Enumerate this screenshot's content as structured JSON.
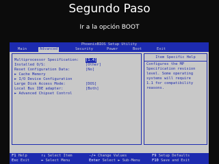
{
  "slide": {
    "title": "Segundo Paso",
    "subtitle": "Ir a la opción BOOT"
  },
  "bios": {
    "title": "PhoenixBIOS Setup Utility",
    "menu": [
      "Main",
      "Advanced",
      "Security",
      "Power",
      "Boot",
      "Exit"
    ],
    "active_menu": "Advanced",
    "settings": [
      {
        "label": "Multiprocessor Specification:",
        "value": "[1.4]",
        "selected": true
      },
      {
        "label": "Installed O/S:",
        "value": "[Other]"
      },
      {
        "label": "Reset Configuration Data:",
        "value": "[No]"
      },
      {
        "label": "► Cache Memory",
        "value": ""
      },
      {
        "label": "► I/O Device Configuration",
        "value": ""
      },
      {
        "label": "Large Disk Access Mode:",
        "value": "[DOS]"
      },
      {
        "label": "Local Bus IDE adapter:",
        "value": "[Both]"
      },
      {
        "label": "► Advanced Chipset Control",
        "value": ""
      }
    ],
    "help": {
      "title": "Item Specific Help",
      "lines": [
        "Configures the MP",
        "Specification revision",
        "level.  Some operating",
        "systems will require",
        "1.1 for compatibility",
        "reasons."
      ]
    },
    "footer": [
      {
        "key": "F1",
        "action": "Help"
      },
      {
        "key": "↑↓",
        "action": "Select Item"
      },
      {
        "key": "-/+",
        "action": "Change Values"
      },
      {
        "key": "F9",
        "action": "Setup Defaults"
      },
      {
        "key": "Esc",
        "action": "Exit"
      },
      {
        "key": "↔",
        "action": "Select Menu"
      },
      {
        "key": "Enter",
        "action": "Select ► Sub-Menu"
      },
      {
        "key": "F10",
        "action": "Save and Exit"
      }
    ]
  }
}
